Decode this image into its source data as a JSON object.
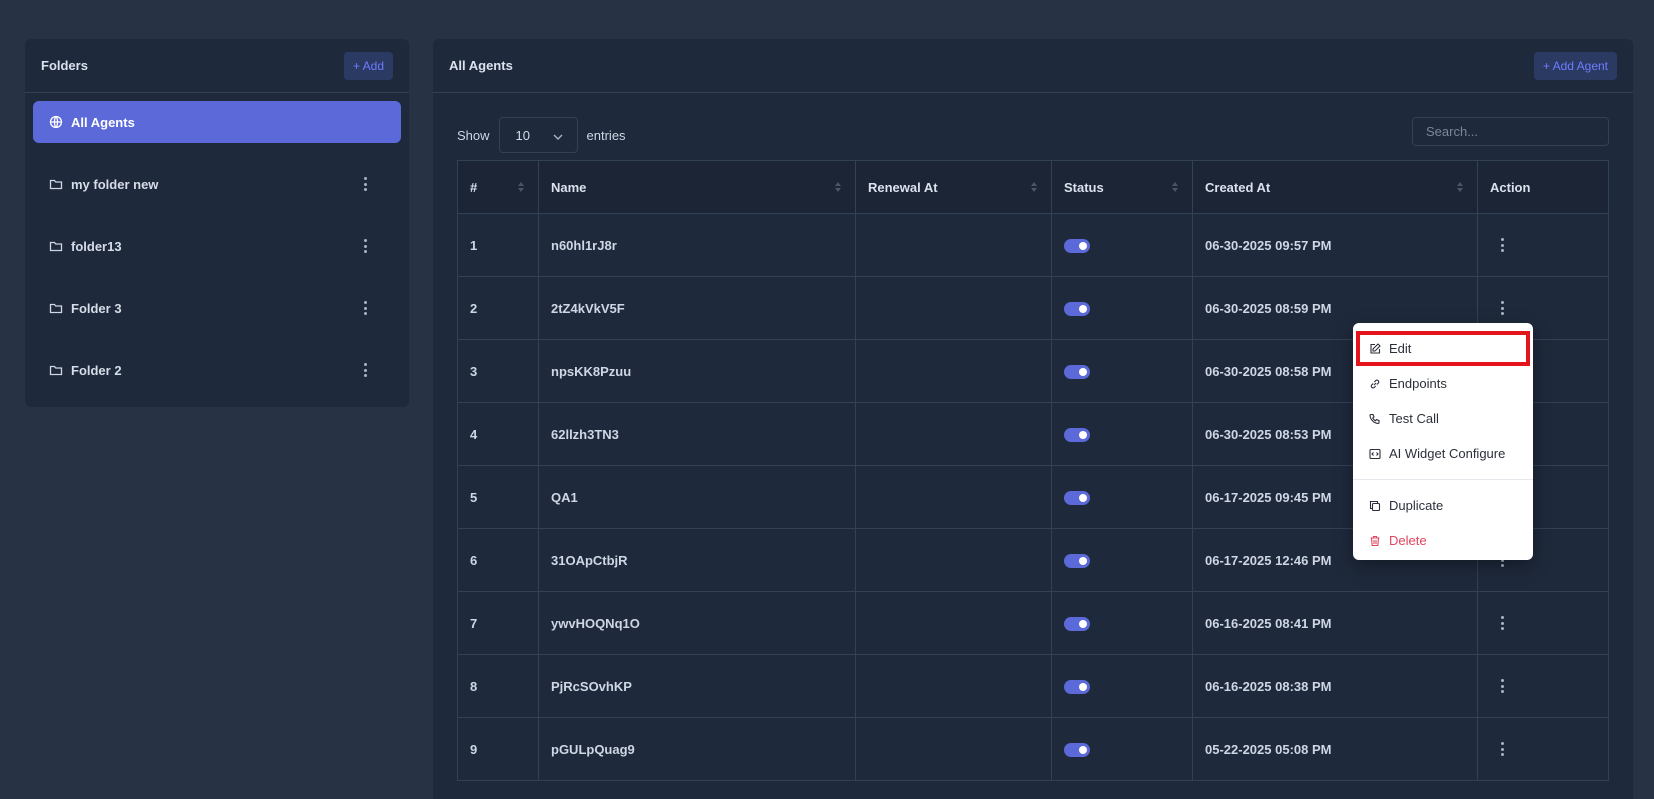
{
  "folders_panel": {
    "title": "Folders",
    "add_label": "+ Add",
    "items": [
      {
        "label": "All Agents",
        "icon": "globe-icon",
        "active": true
      },
      {
        "label": "my folder new",
        "icon": "folder-icon"
      },
      {
        "label": "folder13",
        "icon": "folder-icon"
      },
      {
        "label": "Folder 3",
        "icon": "folder-icon"
      },
      {
        "label": "Folder 2",
        "icon": "folder-icon"
      }
    ]
  },
  "agents_panel": {
    "title": "All Agents",
    "add_label": "+ Add Agent",
    "show_label": "Show",
    "entries_value": "10",
    "entries_label": "entries",
    "search_placeholder": "Search...",
    "columns": [
      "#",
      "Name",
      "Renewal At",
      "Status",
      "Created At",
      "Action"
    ],
    "rows": [
      {
        "num": "1",
        "name": "n60hl1rJ8r",
        "renewal": "",
        "status": true,
        "created": "06-30-2025 09:57 PM"
      },
      {
        "num": "2",
        "name": "2tZ4kVkV5F",
        "renewal": "",
        "status": true,
        "created": "06-30-2025 08:59 PM"
      },
      {
        "num": "3",
        "name": "npsKK8Pzuu",
        "renewal": "",
        "status": true,
        "created": "06-30-2025 08:58 PM"
      },
      {
        "num": "4",
        "name": "62llzh3TN3",
        "renewal": "",
        "status": true,
        "created": "06-30-2025 08:53 PM"
      },
      {
        "num": "5",
        "name": "QA1",
        "renewal": "",
        "status": true,
        "created": "06-17-2025 09:45 PM"
      },
      {
        "num": "6",
        "name": "31OApCtbjR",
        "renewal": "",
        "status": true,
        "created": "06-17-2025 12:46 PM"
      },
      {
        "num": "7",
        "name": "ywvHOQNq1O",
        "renewal": "",
        "status": true,
        "created": "06-16-2025 08:41 PM"
      },
      {
        "num": "8",
        "name": "PjRcSOvhKP",
        "renewal": "",
        "status": true,
        "created": "06-16-2025 08:38 PM"
      },
      {
        "num": "9",
        "name": "pGULpQuag9",
        "renewal": "",
        "status": true,
        "created": "05-22-2025 05:08 PM"
      }
    ]
  },
  "action_menu": {
    "items": [
      {
        "label": "Edit",
        "icon": "edit-icon"
      },
      {
        "label": "Endpoints",
        "icon": "link-icon"
      },
      {
        "label": "Test Call",
        "icon": "phone-icon"
      },
      {
        "label": "AI Widget Configure",
        "icon": "code-icon"
      },
      {
        "label": "Duplicate",
        "icon": "copy-icon"
      },
      {
        "label": "Delete",
        "icon": "trash-icon"
      }
    ]
  },
  "colors": {
    "background": "#273245",
    "card": "#1e293b",
    "accent": "#5b6ad8",
    "danger": "#e2435f",
    "highlight_box": "#e3141b"
  }
}
